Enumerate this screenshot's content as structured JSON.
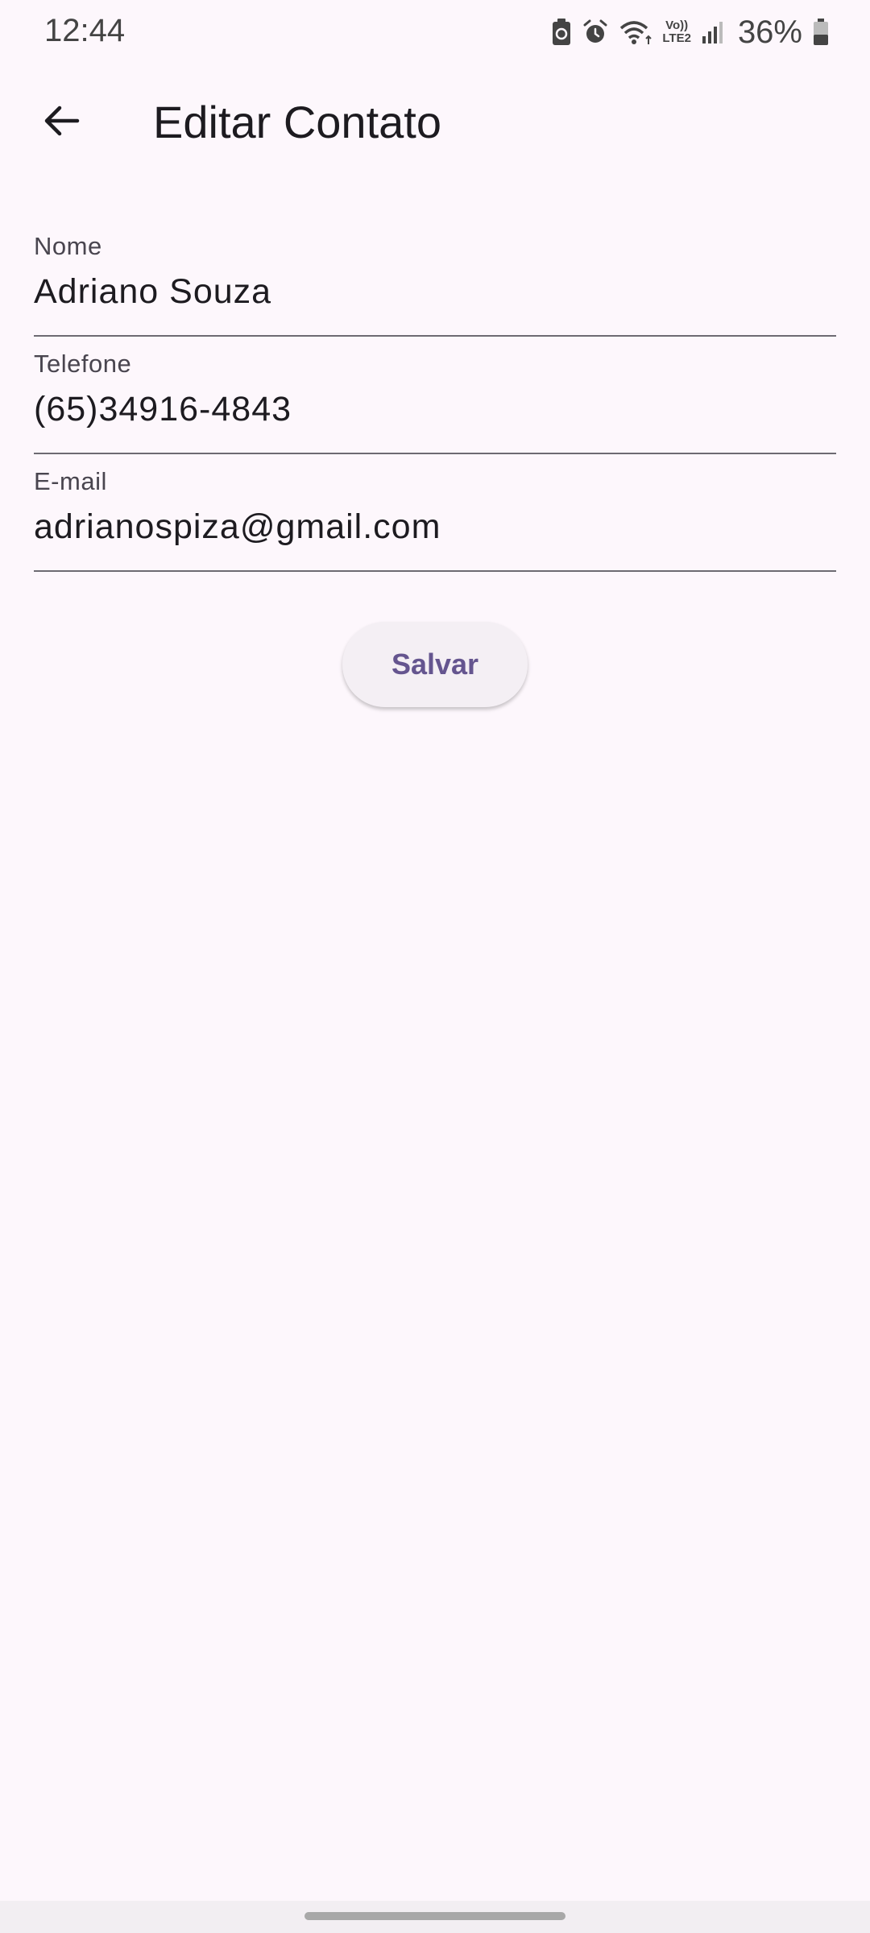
{
  "status_bar": {
    "time": "12:44",
    "icons": [
      "battery-saver-icon",
      "alarm-icon",
      "wifi-icon",
      "volte-icon",
      "signal-icon",
      "battery-icon"
    ],
    "volte_line1": "Vo))",
    "volte_line2": "LTE2",
    "battery_percent": "36%"
  },
  "app_bar": {
    "back_icon": "arrow-back-icon",
    "title": "Editar Contato"
  },
  "form": {
    "fields": [
      {
        "label": "Nome",
        "value": "Adriano Souza"
      },
      {
        "label": "Telefone",
        "value": "(65)34916-4843"
      },
      {
        "label": "E-mail",
        "value": "adrianospiza@gmail.com"
      }
    ],
    "save_label": "Salvar"
  },
  "colors": {
    "background": "#fdf7fc",
    "button_text": "#65558f",
    "button_background": "#f4eff4",
    "underline": "#6d6a72"
  }
}
